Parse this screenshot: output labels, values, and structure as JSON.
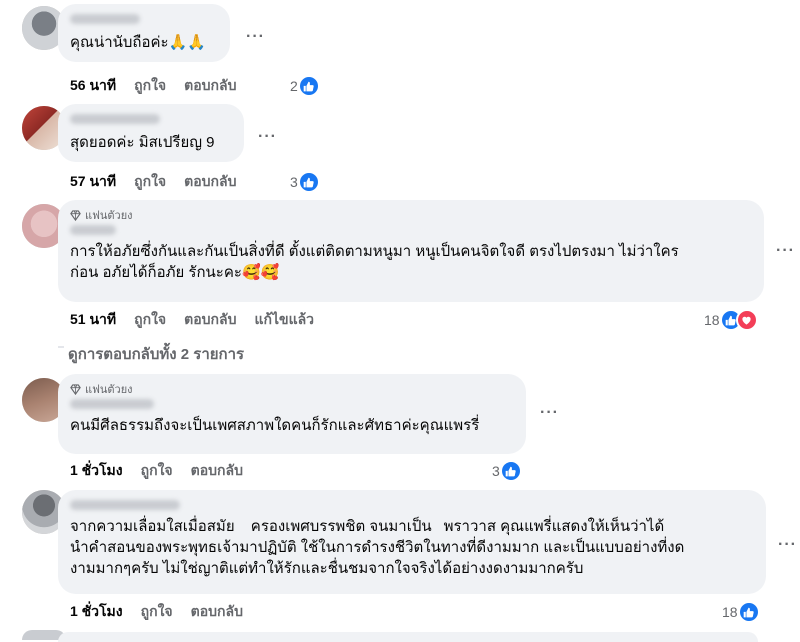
{
  "comments": [
    {
      "text": "คุณน่านับถือค่ะ🙏🙏",
      "time": "56 นาที",
      "like": "ถูกใจ",
      "reply": "ตอบกลับ",
      "reaction_count": "2",
      "more": "···"
    },
    {
      "text": "สุดยอดค่ะ มิสเปรียญ 9",
      "time": "57 นาที",
      "like": "ถูกใจ",
      "reply": "ตอบกลับ",
      "reaction_count": "3",
      "more": "···"
    },
    {
      "badge": "แฟนตัวยง",
      "text": "การให้อภัยซึ่งกันและกันเป็นสิ่งที่ดี ตั้งแต่ติดตามหนูมา หนูเป็นคนจิตใจดี ตรงไปตรงมา ไม่ว่าใคร\nก่อน อภัยได้ก็อภัย รักนะคะ🥰🥰",
      "time": "51 นาที",
      "like": "ถูกใจ",
      "reply": "ตอบกลับ",
      "edited": "แก้ไขแล้ว",
      "reaction_count": "18",
      "more": "···"
    },
    {
      "badge": "แฟนตัวยง",
      "text": "คนมีศีลธรรมถึงจะเป็นเพศสภาพใดคนก็รักและศัทธาค่ะคุณแพรรี่",
      "time": "1 ชั่วโมง",
      "like": "ถูกใจ",
      "reply": "ตอบกลับ",
      "reaction_count": "3",
      "more": "···"
    },
    {
      "text": "จากความเลื่อมใสเมื่อสมัย ครองเพศบรรพชิต จนมาเป็นพราวาส คุณแพรี่แสดงให้เห็นว่าได้\nนำคำสอนของพระพุทธเจ้ามาปฏิบัติ ใช้ในการดำรงชีวิตในทางที่ดีงามมาก และเป็นแบบอย่างที่งด\nงามมากๆครับ ไม่ใช่ญาติแต่ทำให้รักและชื่นชมจากใจจริงได้อย่างงดงามมากครับ",
      "time": "1 ชั่วโมง",
      "like": "ถูกใจ",
      "reply": "ตอบกลับ",
      "reaction_count": "18",
      "more": "···"
    }
  ],
  "view_replies": "ดูการตอบกลับทั้ง 2 รายการ",
  "colors": {
    "like_blue": "#1877f2",
    "love_red": "#f33e58",
    "bubble": "#f0f2f5",
    "muted_text": "#65676b"
  }
}
